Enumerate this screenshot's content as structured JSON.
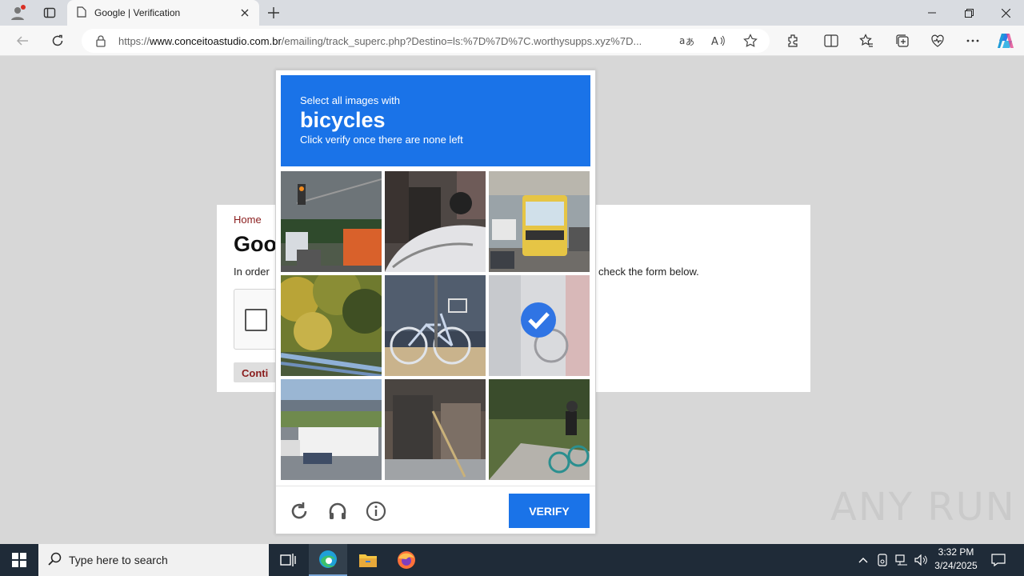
{
  "browser": {
    "tab_title": "Google | Verification",
    "url_prefix": "https://",
    "url_domain": "www.conceitoastudio.com.br",
    "url_rest": "/emailing/track_superc.php?Destino=ls:%7D%7D%7C.worthysupps.xyz%7D..."
  },
  "page": {
    "breadcrumb": "Home",
    "title_partial": "Goo",
    "description_left": "In order",
    "description_right": "check the form below.",
    "continue_label": "Conti"
  },
  "captcha": {
    "instruction": "Select all images with",
    "target": "bicycles",
    "hint": "Click verify once there are none left",
    "verify_label": "VERIFY",
    "header_color": "#1a73e8",
    "tiles": [
      {
        "subject": "traffic-light-and-trucks",
        "selected": false
      },
      {
        "subject": "motorcycle-and-car",
        "selected": false
      },
      {
        "subject": "bus-on-street",
        "selected": false
      },
      {
        "subject": "autumn-trees-and-guardrail",
        "selected": false
      },
      {
        "subject": "bicycle-with-basket",
        "selected": false
      },
      {
        "subject": "bicycle-near-wall",
        "selected": true
      },
      {
        "subject": "highway-truck",
        "selected": false
      },
      {
        "subject": "building-entrance",
        "selected": false
      },
      {
        "subject": "cyclist-on-path",
        "selected": false
      }
    ]
  },
  "watermark": "ANY RUN",
  "taskbar": {
    "search_placeholder": "Type here to search",
    "time": "3:32 PM",
    "date": "3/24/2025"
  }
}
